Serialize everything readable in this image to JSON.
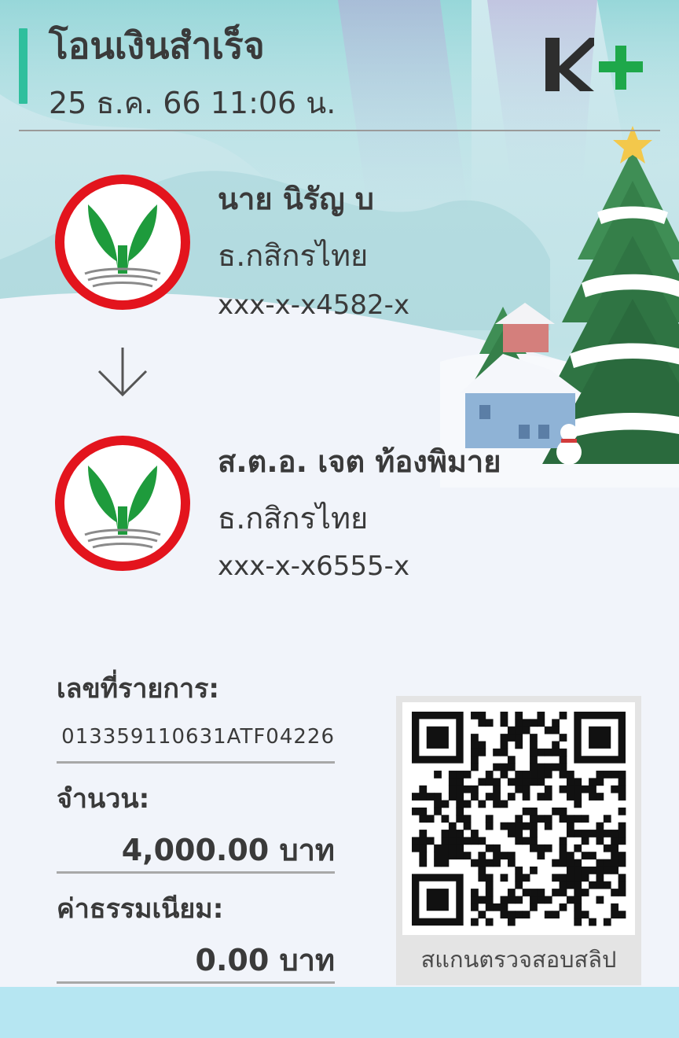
{
  "header": {
    "title": "โอนเงินสำเร็จ",
    "datetime": "25 ธ.ค. 66  11:06 น.",
    "logo_icon": "kplus-logo",
    "accent_color": "#2fbf9d"
  },
  "sender": {
    "name": "นาย นิรัญ บ",
    "bank": "ธ.กสิกรไทย",
    "account": "xxx-x-x4582-x",
    "logo_icon": "kasikorn-bank-logo"
  },
  "transfer_arrow_icon": "arrow-down-icon",
  "receiver": {
    "name": "ส.ต.อ. เจต ท้องพิมาย",
    "bank": "ธ.กสิกรไทย",
    "account": "xxx-x-x6555-x",
    "logo_icon": "kasikorn-bank-logo"
  },
  "details": {
    "ref_label": "เลขที่รายการ:",
    "ref_value": "013359110631ATF04226",
    "amount_label": "จำนวน:",
    "amount_value": "4,000.00 บาท",
    "fee_label": "ค่าธรรมเนียม:",
    "fee_value": "0.00 บาท"
  },
  "qr": {
    "caption": "สแกนตรวจสอบสลิป",
    "icon": "qr-code"
  },
  "colors": {
    "brand_green": "#2fbf9d",
    "bank_red": "#e3141d",
    "bank_green": "#1e9b3c",
    "footer": "#b6e6f2"
  }
}
